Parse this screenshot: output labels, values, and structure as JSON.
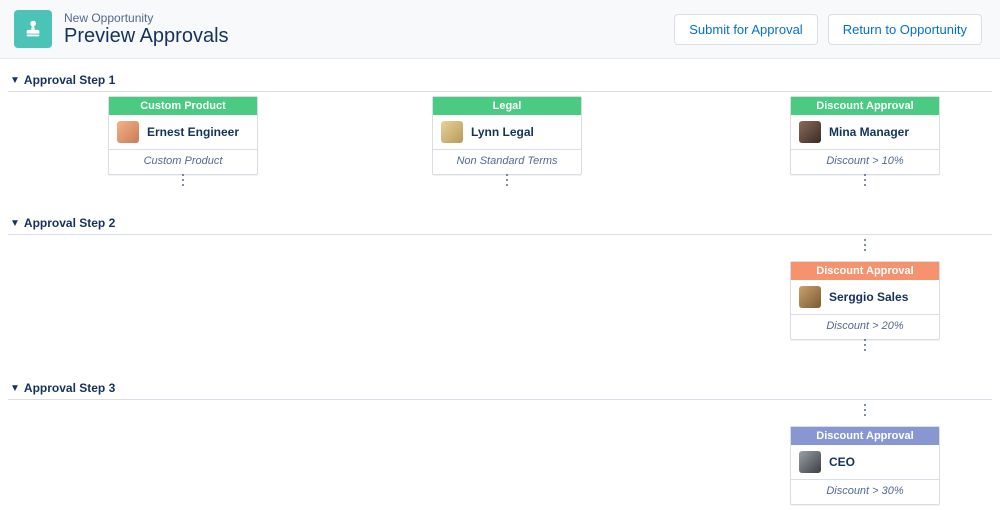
{
  "header": {
    "breadcrumb": "New Opportunity",
    "title": "Preview Approvals",
    "submit_label": "Submit for Approval",
    "return_label": "Return to Opportunity"
  },
  "steps": {
    "s1": {
      "label": "Approval Step 1",
      "cards": {
        "custom_product": {
          "title": "Custom Product",
          "approver": "Ernest Engineer",
          "rule": "Custom Product"
        },
        "legal": {
          "title": "Legal",
          "approver": "Lynn Legal",
          "rule": "Non Standard Terms"
        },
        "discount": {
          "title": "Discount Approval",
          "approver": "Mina Manager",
          "rule": "Discount > 10%"
        }
      }
    },
    "s2": {
      "label": "Approval Step 2",
      "cards": {
        "discount": {
          "title": "Discount Approval",
          "approver": "Serggio Sales",
          "rule": "Discount > 20%"
        }
      }
    },
    "s3": {
      "label": "Approval Step 3",
      "cards": {
        "discount": {
          "title": "Discount Approval",
          "approver": "CEO",
          "rule": "Discount > 30%"
        }
      }
    }
  }
}
